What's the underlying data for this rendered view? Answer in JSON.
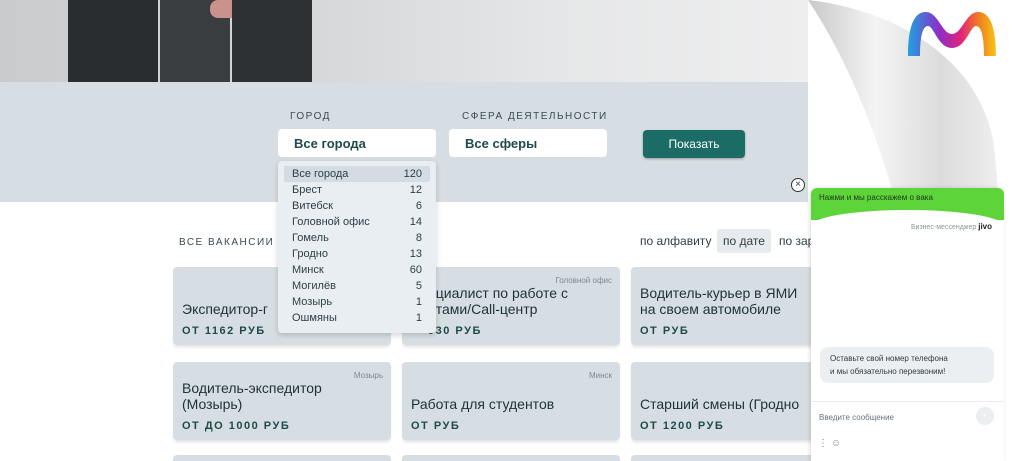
{
  "filters": {
    "city_label": "ГОРОД",
    "city_value": "Все города",
    "sphere_label": "СФЕРА ДЕЯТЕЛЬНОСТИ",
    "sphere_value": "Все сферы",
    "show_button": "Показать"
  },
  "city_dropdown": [
    {
      "name": "Все города",
      "count": "120"
    },
    {
      "name": "Брест",
      "count": "12"
    },
    {
      "name": "Витебск",
      "count": "6"
    },
    {
      "name": "Головной офис",
      "count": "14"
    },
    {
      "name": "Гомель",
      "count": "8"
    },
    {
      "name": "Гродно",
      "count": "13"
    },
    {
      "name": "Минск",
      "count": "60"
    },
    {
      "name": "Могилёв",
      "count": "5"
    },
    {
      "name": "Мозырь",
      "count": "1"
    },
    {
      "name": "Ошмяны",
      "count": "1"
    }
  ],
  "list": {
    "title": "ВСЕ ВАКАНСИИ 24",
    "sort": [
      "по алфавиту",
      "по дате",
      "по зар"
    ]
  },
  "jobs": [
    {
      "title": "Экспедитор-г",
      "salary": "ОТ 1162 РУБ",
      "city": ""
    },
    {
      "title": "ециалист по работе с",
      "title2": "нтами/Call-центр",
      "salary": "930 РУБ",
      "city": "Головной офис"
    },
    {
      "title": "Водитель-курьер в ЯМИ",
      "title2": "на своем автомобиле",
      "salary": "ОТ РУБ",
      "city": ""
    },
    {
      "title": "Водитель-экспедитор",
      "title2": "(Мозырь)",
      "salary": "ОТ ДО 1000 РУБ",
      "city": "Мозырь"
    },
    {
      "title": "Работа для студентов",
      "salary": "ОТ РУБ",
      "city": "Минск"
    },
    {
      "title": "Старший смены (Гродно",
      "salary": "ОТ 1200 РУБ",
      "city": ""
    }
  ],
  "chat": {
    "header": "Нажми и мы расскажем о вака",
    "brand_prefix": "Бизнес-мессенджер",
    "brand_name": "jivo",
    "bubble_line1": "Оставьте свой номер телефона",
    "bubble_line2": "и мы обязательно перезвоним!",
    "input_placeholder": "Введите сообщение",
    "close": "×"
  },
  "colors": {
    "accent": "#1b6b67",
    "filter_band": "#d6dee3",
    "chat_header": "#5cd43a"
  }
}
